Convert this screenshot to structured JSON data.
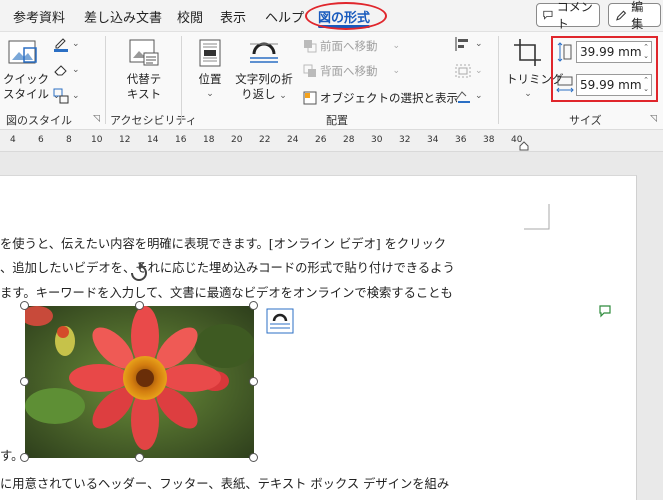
{
  "menu": {
    "tabs": [
      "参考資料",
      "差し込み文書",
      "校閲",
      "表示",
      "ヘルプ"
    ],
    "active_tab": "図の形式",
    "comment_button": "コメント",
    "edit_button": "編集"
  },
  "ribbon": {
    "style_group": {
      "quick_style_line1": "クイック",
      "quick_style_line2": "スタイル",
      "label": "図のスタイル"
    },
    "accessibility_group": {
      "alt_text_line1": "代替テ",
      "alt_text_line2": "キスト",
      "label": "アクセシビリティ"
    },
    "arrange_group": {
      "position": "位置",
      "wrap_line1": "文字列の折",
      "wrap_line2": "り返し",
      "bring_forward": "前面へ移動",
      "send_backward": "背面へ移動",
      "selection_pane": "オブジェクトの選択と表示",
      "label": "配置"
    },
    "size_group": {
      "crop": "トリミング",
      "height": "39.99 mm",
      "width": "59.99 mm",
      "label": "サイズ"
    }
  },
  "ruler": {
    "numbers": [
      "4",
      "6",
      "8",
      "10",
      "12",
      "14",
      "16",
      "18",
      "20",
      "22",
      "24",
      "26",
      "28",
      "30",
      "32",
      "34",
      "36",
      "38",
      "40"
    ]
  },
  "document": {
    "lines": [
      "を使うと、伝えたい内容を明確に表現できます。[オンライン ビデオ] をクリック",
      "、追加したいビデオを、それに応じた埋め込みコードの形式で貼り付けできるよう",
      "ます。キーワードを入力して、文書に最適なビデオをオンラインで検索することも",
      "す。",
      "に用意されているヘッダー、フッター、表紙、テキスト ボックス デザインを組み"
    ]
  },
  "colors": {
    "accent": "#185abd",
    "highlight": "#e0262c"
  }
}
